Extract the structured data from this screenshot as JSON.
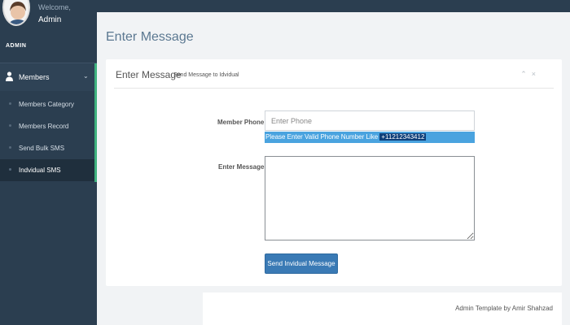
{
  "sidebar": {
    "welcome": "Welcome,",
    "username": "Admin",
    "role": "ADMIN",
    "menu": {
      "label": "Members",
      "icon": "user-icon",
      "expand_icon": "chevron-down-icon",
      "items": [
        {
          "label": "Members Category"
        },
        {
          "label": "Members Record"
        },
        {
          "label": "Send Bulk SMS"
        },
        {
          "label": "Indvidual SMS",
          "active": true
        }
      ]
    }
  },
  "page": {
    "title": "Enter Message"
  },
  "panel": {
    "title": "Enter Message",
    "subtitle": "Send Message to Idvidual",
    "tools": [
      "chevron-up-icon",
      "close-icon"
    ]
  },
  "form": {
    "phone_label": "Member Phone",
    "phone_placeholder": "Enter Phone",
    "phone_hint": "Please Enter Valid Phone Number Like ",
    "phone_example": "+11212343412",
    "message_label": "Enter Message",
    "send_label": "Send Invidual Message"
  },
  "footer": {
    "text": "Admin Template by Amir Shahzad"
  },
  "colors": {
    "sidebar": "#2b3e50",
    "accent": "#3fb27f",
    "button": "#3a7ab5",
    "hint": "#4aa3df"
  }
}
